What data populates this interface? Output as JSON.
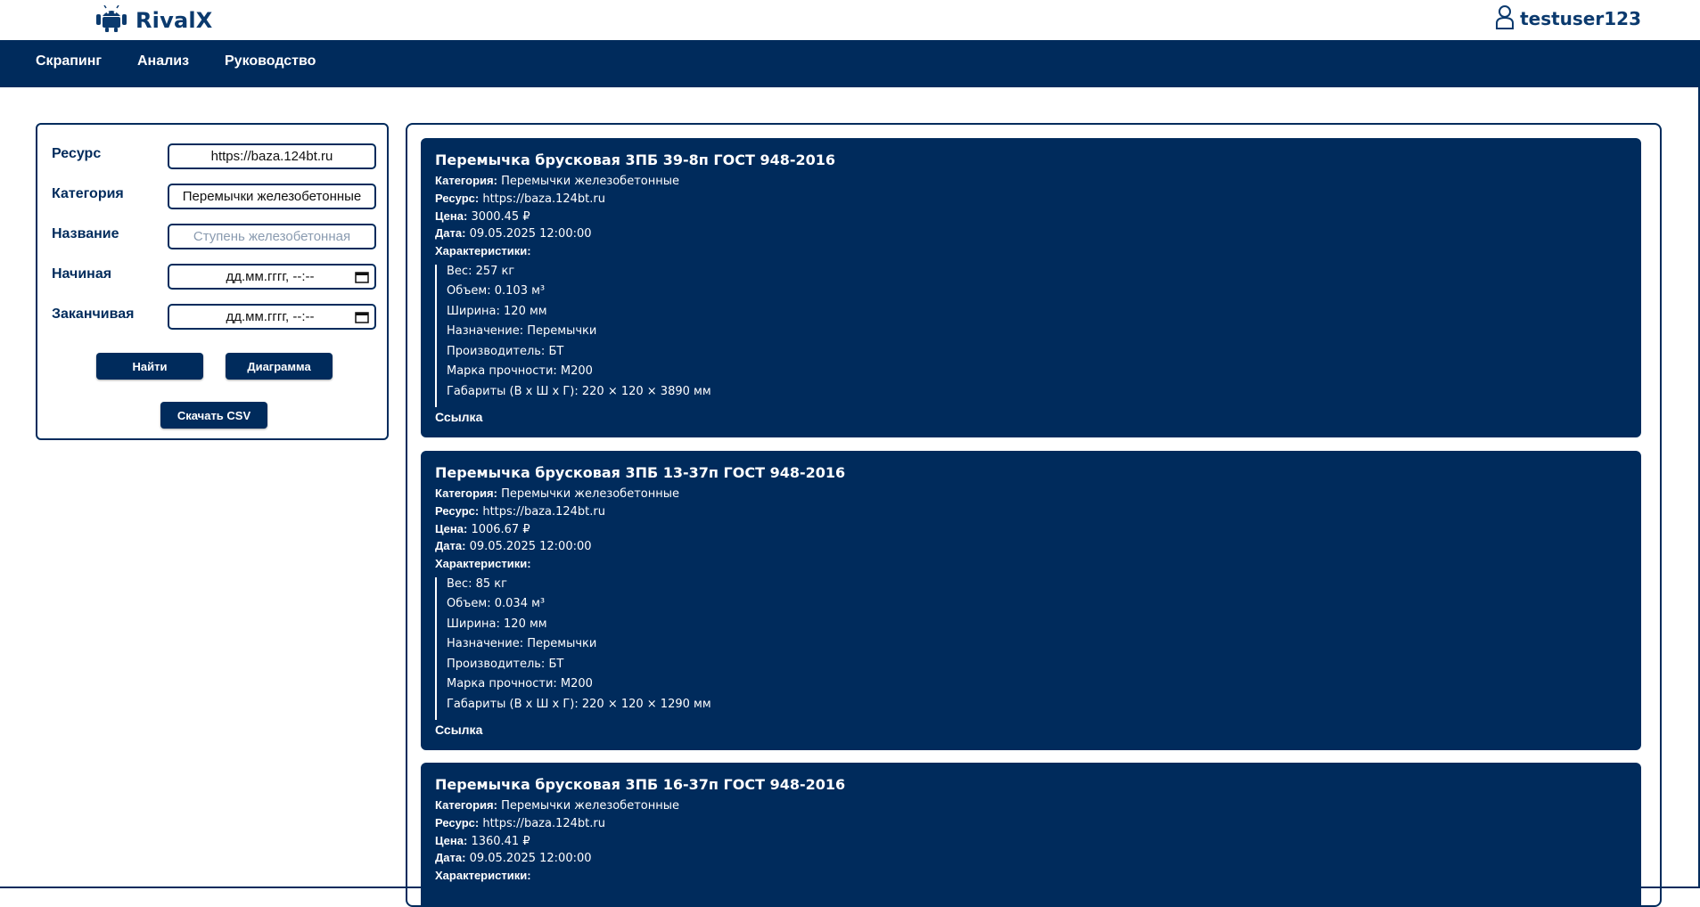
{
  "header": {
    "logo_text": "RivalX",
    "username": "testuser123"
  },
  "nav": {
    "items": [
      {
        "label": "Скрапинг"
      },
      {
        "label": "Анализ"
      },
      {
        "label": "Руководство"
      }
    ]
  },
  "filters": {
    "resource_label": "Ресурс",
    "resource_value": "https://baza.124bt.ru",
    "category_label": "Категория",
    "category_value": "Перемычки железобетонные",
    "name_label": "Название",
    "name_placeholder": "Ступень железобетонная",
    "start_label": "Начиная",
    "start_placeholder": "дд.мм.гггг, --:--",
    "end_label": "Заканчивая",
    "end_placeholder": "дд.мм.гггг, --:--",
    "find_button": "Найти",
    "chart_button": "Диаграмма",
    "csv_button": "Скачать CSV"
  },
  "labels": {
    "category": "Категория:",
    "resource": "Ресурс:",
    "price": "Цена:",
    "date": "Дата:",
    "characteristics": "Характеристики:",
    "link": "Ссылка"
  },
  "products": [
    {
      "title": "Перемычка брусковая 3ПБ 39-8п ГОСТ 948-2016",
      "category": "Перемычки железобетонные",
      "resource": "https://baza.124bt.ru",
      "price": "3000.45 ₽",
      "date": "09.05.2025 12:00:00",
      "specs": [
        "Вес: 257 кг",
        "Объем: 0.103 м³",
        "Ширина: 120 мм",
        "Назначение: Перемычки",
        "Производитель: БТ",
        "Марка прочности: М200",
        "Габариты (В х Ш х Г): 220 × 120 × 3890 мм"
      ]
    },
    {
      "title": "Перемычка брусковая 3ПБ 13-37п ГОСТ 948-2016",
      "category": "Перемычки железобетонные",
      "resource": "https://baza.124bt.ru",
      "price": "1006.67 ₽",
      "date": "09.05.2025 12:00:00",
      "specs": [
        "Вес: 85 кг",
        "Объем: 0.034 м³",
        "Ширина: 120 мм",
        "Назначение: Перемычки",
        "Производитель: БТ",
        "Марка прочности: М200",
        "Габариты (В х Ш х Г): 220 × 120 × 1290 мм"
      ]
    },
    {
      "title": "Перемычка брусковая 3ПБ 16-37п ГОСТ 948-2016",
      "category": "Перемычки железобетонные",
      "resource": "https://baza.124bt.ru",
      "price": "1360.41 ₽",
      "date": "09.05.2025 12:00:00",
      "specs": []
    }
  ]
}
